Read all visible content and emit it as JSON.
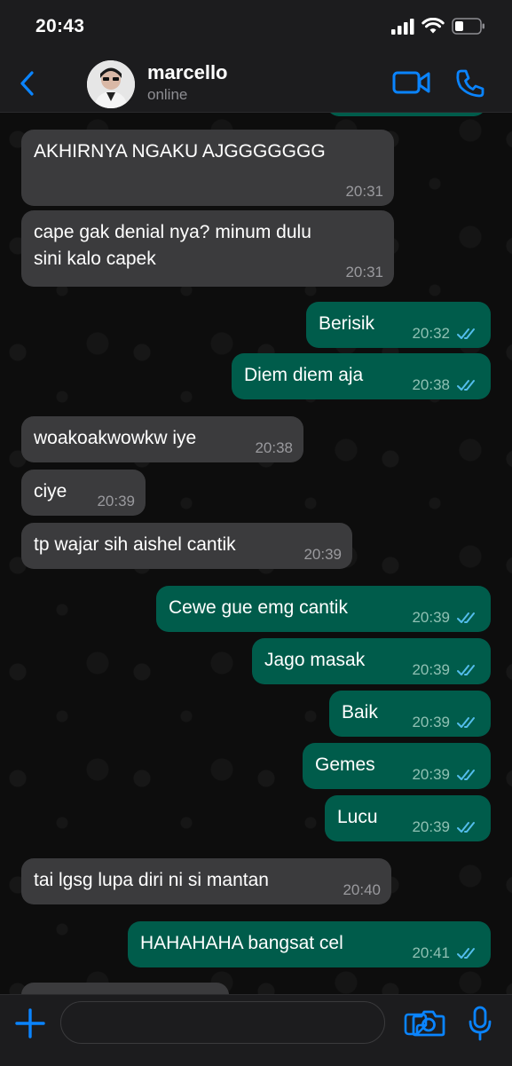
{
  "status_bar": {
    "time": "20:43"
  },
  "header": {
    "name": "marcello",
    "status": "online"
  },
  "colors": {
    "accent": "#0a84ff",
    "incoming": "#3b3b3d",
    "outgoing": "#005c4b",
    "read_ticks": "#53bdeb"
  },
  "messages": [
    {
      "dir": "in",
      "text": "AKHIRNYA NGAKU AJGGGGGGG",
      "time": "20:31"
    },
    {
      "dir": "in",
      "text": "cape gak denial nya? minum dulu\nsini kalo capek",
      "time": "20:31"
    },
    {
      "dir": "out",
      "text": "Berisik",
      "time": "20:32"
    },
    {
      "dir": "out",
      "text": "Diem diem aja",
      "time": "20:38"
    },
    {
      "dir": "in",
      "text": "woakoakwowkw iye",
      "time": "20:38"
    },
    {
      "dir": "in",
      "text": "ciye",
      "time": "20:39"
    },
    {
      "dir": "in",
      "text": "tp wajar sih aishel cantik",
      "time": "20:39"
    },
    {
      "dir": "out",
      "text": "Cewe gue emg cantik",
      "time": "20:39"
    },
    {
      "dir": "out",
      "text": "Jago masak",
      "time": "20:39"
    },
    {
      "dir": "out",
      "text": "Baik",
      "time": "20:39"
    },
    {
      "dir": "out",
      "text": "Gemes",
      "time": "20:39"
    },
    {
      "dir": "out",
      "text": "Lucu",
      "time": "20:39"
    },
    {
      "dir": "in",
      "text": "tai lgsg lupa diri ni si mantan",
      "time": "20:40"
    },
    {
      "dir": "out",
      "text": "HAHAHAHA bangsat cel",
      "time": "20:41"
    }
  ],
  "icons": [
    "back-chevron-icon",
    "video-call-icon",
    "phone-icon",
    "plus-icon",
    "sticker-icon",
    "camera-icon",
    "microphone-icon"
  ]
}
